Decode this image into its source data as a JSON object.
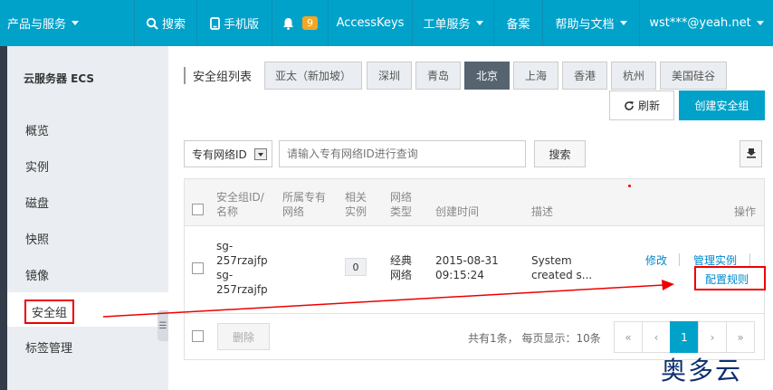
{
  "topbar": {
    "products": "产品与服务",
    "search": "搜索",
    "mobile": "手机版",
    "notifications": "9",
    "accesskeys": "AccessKeys",
    "tickets": "工单服务",
    "beian": "备案",
    "help": "帮助与文档",
    "account": "wst***@yeah.net"
  },
  "sidebar": {
    "title": "云服务器 ECS",
    "items": [
      "概览",
      "实例",
      "磁盘",
      "快照",
      "镜像",
      "安全组",
      "标签管理"
    ],
    "collapse_glyph": "☰"
  },
  "regions": {
    "label": "安全组列表",
    "tabs": [
      "亚太（新加坡）",
      "深圳",
      "青岛",
      "北京",
      "上海",
      "香港",
      "杭州",
      "美国硅谷"
    ],
    "active": "北京"
  },
  "actions": {
    "refresh": "刷新",
    "create": "创建安全组"
  },
  "search": {
    "select_value": "专有网络ID",
    "placeholder": "请输入专有网络ID进行查询",
    "button": "搜索"
  },
  "table": {
    "headers": {
      "id_name": [
        "安全组ID/",
        "名称"
      ],
      "vpc": [
        "所属专有",
        "网络"
      ],
      "instances": [
        "相关",
        "实例"
      ],
      "net_type": [
        "网络",
        "类型"
      ],
      "created": "创建时间",
      "desc": "描述",
      "ops": "操作"
    },
    "row": {
      "id_lines": [
        "sg-",
        "257rzajfp",
        "sg-",
        "257rzajfp"
      ],
      "instance_count": "0",
      "net_type": [
        "经典",
        "网络"
      ],
      "created": [
        "2015-08-31",
        "09:15:24"
      ],
      "desc": [
        "System",
        "created s..."
      ],
      "op_modify": "修改",
      "op_manage": "管理实例",
      "op_rules": "配置规则"
    },
    "footer": {
      "delete": "删除",
      "summary": "共有1条， 每页显示：10条",
      "pages": [
        "«",
        "‹",
        "1",
        "›",
        "»"
      ],
      "current_page": "1"
    }
  },
  "watermark": "奥多云",
  "colors": {
    "brand": "#00a2ca",
    "annotation": "#e00000",
    "sidebar_bg": "#eaedf1",
    "active_tab": "#566470"
  }
}
